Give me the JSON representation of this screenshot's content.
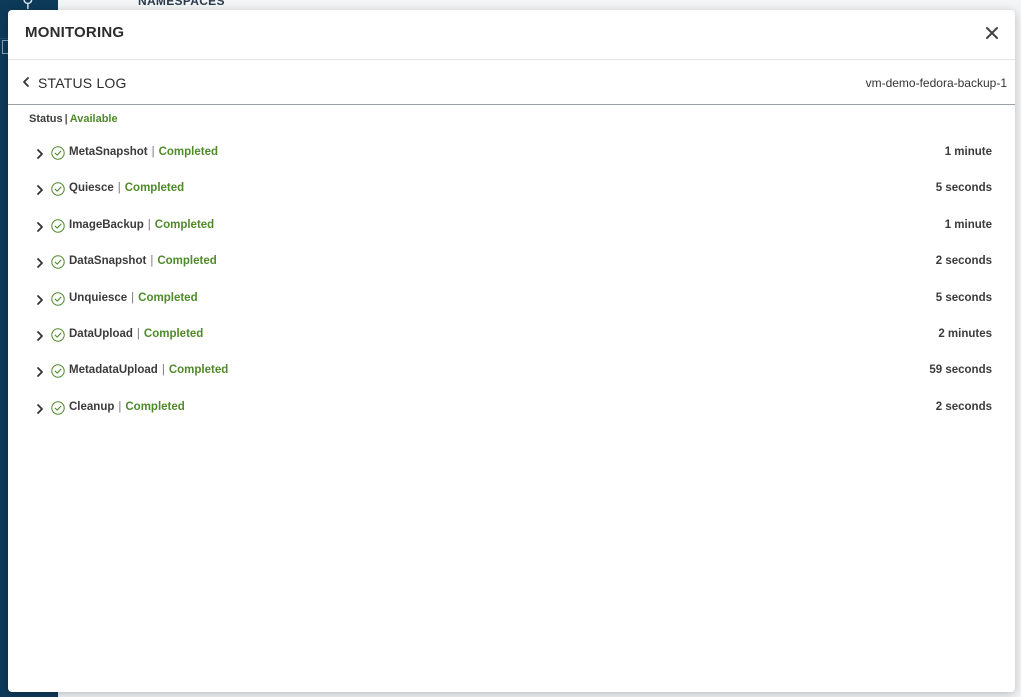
{
  "background": {
    "namespaces_label": "NAMESPACES"
  },
  "modal": {
    "title": "MONITORING",
    "subheader_title": "STATUS LOG",
    "resource_name": "vm-demo-fedora-backup-1",
    "status_label": "Status",
    "status_value": "Available",
    "colors": {
      "success": "#4f8a2b"
    },
    "steps": [
      {
        "name": "MetaSnapshot",
        "state": "Completed",
        "duration": "1 minute"
      },
      {
        "name": "Quiesce",
        "state": "Completed",
        "duration": "5 seconds"
      },
      {
        "name": "ImageBackup",
        "state": "Completed",
        "duration": "1 minute"
      },
      {
        "name": "DataSnapshot",
        "state": "Completed",
        "duration": "2 seconds"
      },
      {
        "name": "Unquiesce",
        "state": "Completed",
        "duration": "5 seconds"
      },
      {
        "name": "DataUpload",
        "state": "Completed",
        "duration": "2 minutes"
      },
      {
        "name": "MetadataUpload",
        "state": "Completed",
        "duration": "59 seconds"
      },
      {
        "name": "Cleanup",
        "state": "Completed",
        "duration": "2 seconds"
      }
    ]
  }
}
